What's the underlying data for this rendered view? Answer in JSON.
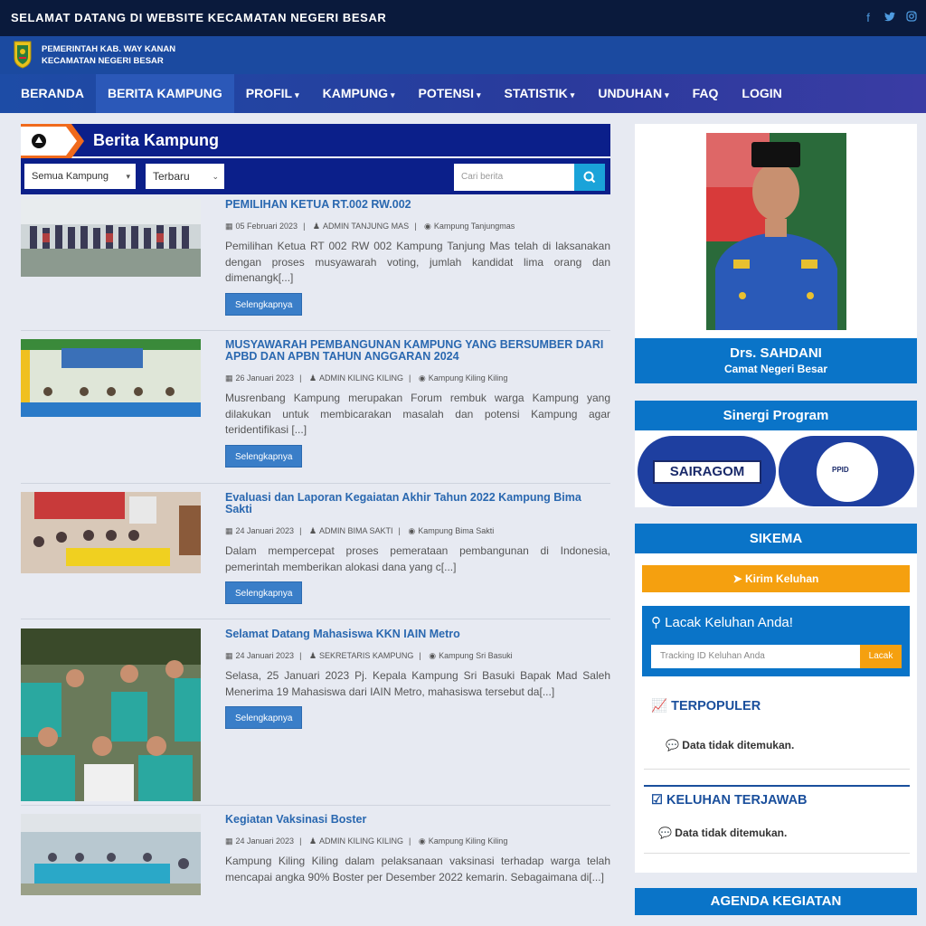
{
  "topbar": {
    "welcome": "SELAMAT DATANG DI WEBSITE KECAMATAN NEGERI BESAR",
    "social": [
      "facebook-icon",
      "twitter-icon",
      "instagram-icon"
    ]
  },
  "brand": {
    "line1": "PEMERINTAH KAB. WAY KANAN",
    "line2": "KECAMATAN NEGERI BESAR"
  },
  "nav": {
    "items": [
      {
        "label": "BERANDA",
        "dropdown": false
      },
      {
        "label": "BERITA KAMPUNG",
        "dropdown": false,
        "active": true
      },
      {
        "label": "PROFIL",
        "dropdown": true
      },
      {
        "label": "KAMPUNG",
        "dropdown": true
      },
      {
        "label": "POTENSI",
        "dropdown": true
      },
      {
        "label": "STATISTIK",
        "dropdown": true
      },
      {
        "label": "UNDUHAN",
        "dropdown": true
      },
      {
        "label": "FAQ",
        "dropdown": false
      },
      {
        "label": "LOGIN",
        "dropdown": false
      }
    ],
    "caret": "▾"
  },
  "section": {
    "title": "Berita Kampung"
  },
  "filters": {
    "kampung": "Semua Kampung",
    "sort": "Terbaru",
    "search_placeholder": "Cari berita"
  },
  "articles": [
    {
      "title": "PEMILIHAN KETUA RT.002 RW.002",
      "date": "05 Februari 2023",
      "author": "ADMIN TANJUNG MAS",
      "kampung": "Kampung Tanjungmas",
      "excerpt": "Pemilihan Ketua RT 002 RW 002 Kampung Tanjung Mas telah di laksanakan dengan proses musyawarah voting, jumlah kandidat lima orang dan dimenangk[...]",
      "button": "Selengkapnya"
    },
    {
      "title": "MUSYAWARAH PEMBANGUNAN KAMPUNG YANG BERSUMBER DARI APBD DAN APBN TAHUN ANGGARAN 2024",
      "date": "26 Januari 2023",
      "author": "ADMIN KILING KILING",
      "kampung": "Kampung Kiling Kiling",
      "excerpt": "Musrenbang Kampung merupakan Forum rembuk warga Kampung yang dilakukan untuk membicarakan masalah dan potensi Kampung agar teridentifikasi [...]",
      "button": "Selengkapnya"
    },
    {
      "title": "Evaluasi dan Laporan Kegaiatan Akhir Tahun 2022 Kampung Bima Sakti",
      "date": "24 Januari 2023",
      "author": "ADMIN BIMA SAKTI",
      "kampung": "Kampung Bima Sakti",
      "excerpt": "Dalam mempercepat proses pemerataan pembangunan di Indonesia, pemerintah memberikan alokasi dana yang c[...]",
      "button": "Selengkapnya"
    },
    {
      "title": "Selamat Datang Mahasiswa KKN IAIN Metro",
      "date": "24 Januari 2023",
      "author": "SEKRETARIS KAMPUNG",
      "kampung": "Kampung Sri Basuki",
      "excerpt": "Selasa, 25 Januari 2023 Pj. Kepala Kampung Sri Basuki Bapak Mad Saleh Menerima 19 Mahasiswa dari IAIN Metro, mahasiswa tersebut da[...]",
      "button": "Selengkapnya"
    },
    {
      "title": "Kegiatan Vaksinasi Boster",
      "date": "24 Januari 2023",
      "author": "ADMIN KILING KILING",
      "kampung": "Kampung Kiling Kiling",
      "excerpt": "Kampung Kiling Kiling dalam pelaksanaan vaksinasi terhadap warga telah mencapai angka 90% Boster per Desember 2022 kemarin. Sebagaimana di[...]",
      "button": "Selengkapnya"
    }
  ],
  "sidebar": {
    "camat_name": "Drs. SAHDANI",
    "camat_title": "Camat Negeri Besar",
    "sinergi_title": "Sinergi Program",
    "sinergi_items": [
      "SAIRAGOM",
      "PPID"
    ],
    "sikema_title": "SIKEMA",
    "kirim_label": "Kirim Keluhan",
    "lacak_title": "Lacak Keluhan Anda!",
    "lacak_placeholder": "Tracking ID Keluhan Anda",
    "lacak_button": "Lacak",
    "populer_title": "TERPOPULER",
    "populer_empty": "Data tidak ditemukan.",
    "terjawab_title": "KELUHAN TERJAWAB",
    "terjawab_empty": "Data tidak ditemukan.",
    "agenda_title": "AGENDA KEGIATAN"
  },
  "colors": {
    "topbar": "#0a1a3c",
    "nav": "#1d4ca6",
    "section_header": "#0b1f8a",
    "sidebar_header": "#0a74c8",
    "accent_orange": "#f5a00f",
    "link": "#2a68b0"
  }
}
